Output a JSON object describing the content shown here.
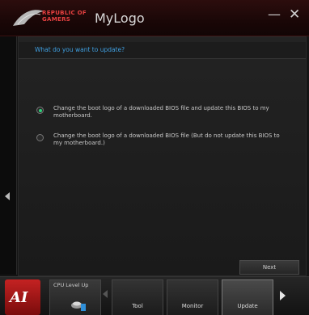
{
  "title_bar": {
    "brand_line1": "REPUBLIC OF",
    "brand_line2": "GAMERS",
    "app_title": "MyLogo",
    "minimize_label": "—",
    "close_label": "✕"
  },
  "main": {
    "question": "What do you want to update?",
    "options": [
      {
        "label": "Change the boot logo of a downloaded BIOS file and update this BIOS to my motherboard.",
        "selected": true
      },
      {
        "label": "Change the boot logo of a downloaded BIOS file (But do not update this BIOS to my motherboard.)",
        "selected": false
      }
    ],
    "next_label": "Next"
  },
  "bottom_bar": {
    "logo_text": "AI",
    "cpu_tile_label": "CPU Level Up",
    "tabs": [
      {
        "label": "Tool"
      },
      {
        "label": "Monitor"
      },
      {
        "label": "Update"
      }
    ]
  },
  "colors": {
    "accent_red": "#c42222",
    "question_blue": "#3f9fe0",
    "radio_green": "#2fd07a"
  },
  "icons": [
    "rog-logo-icon",
    "cpu-level-up-icon",
    "left-arrow-icon",
    "right-arrow-icon"
  ]
}
